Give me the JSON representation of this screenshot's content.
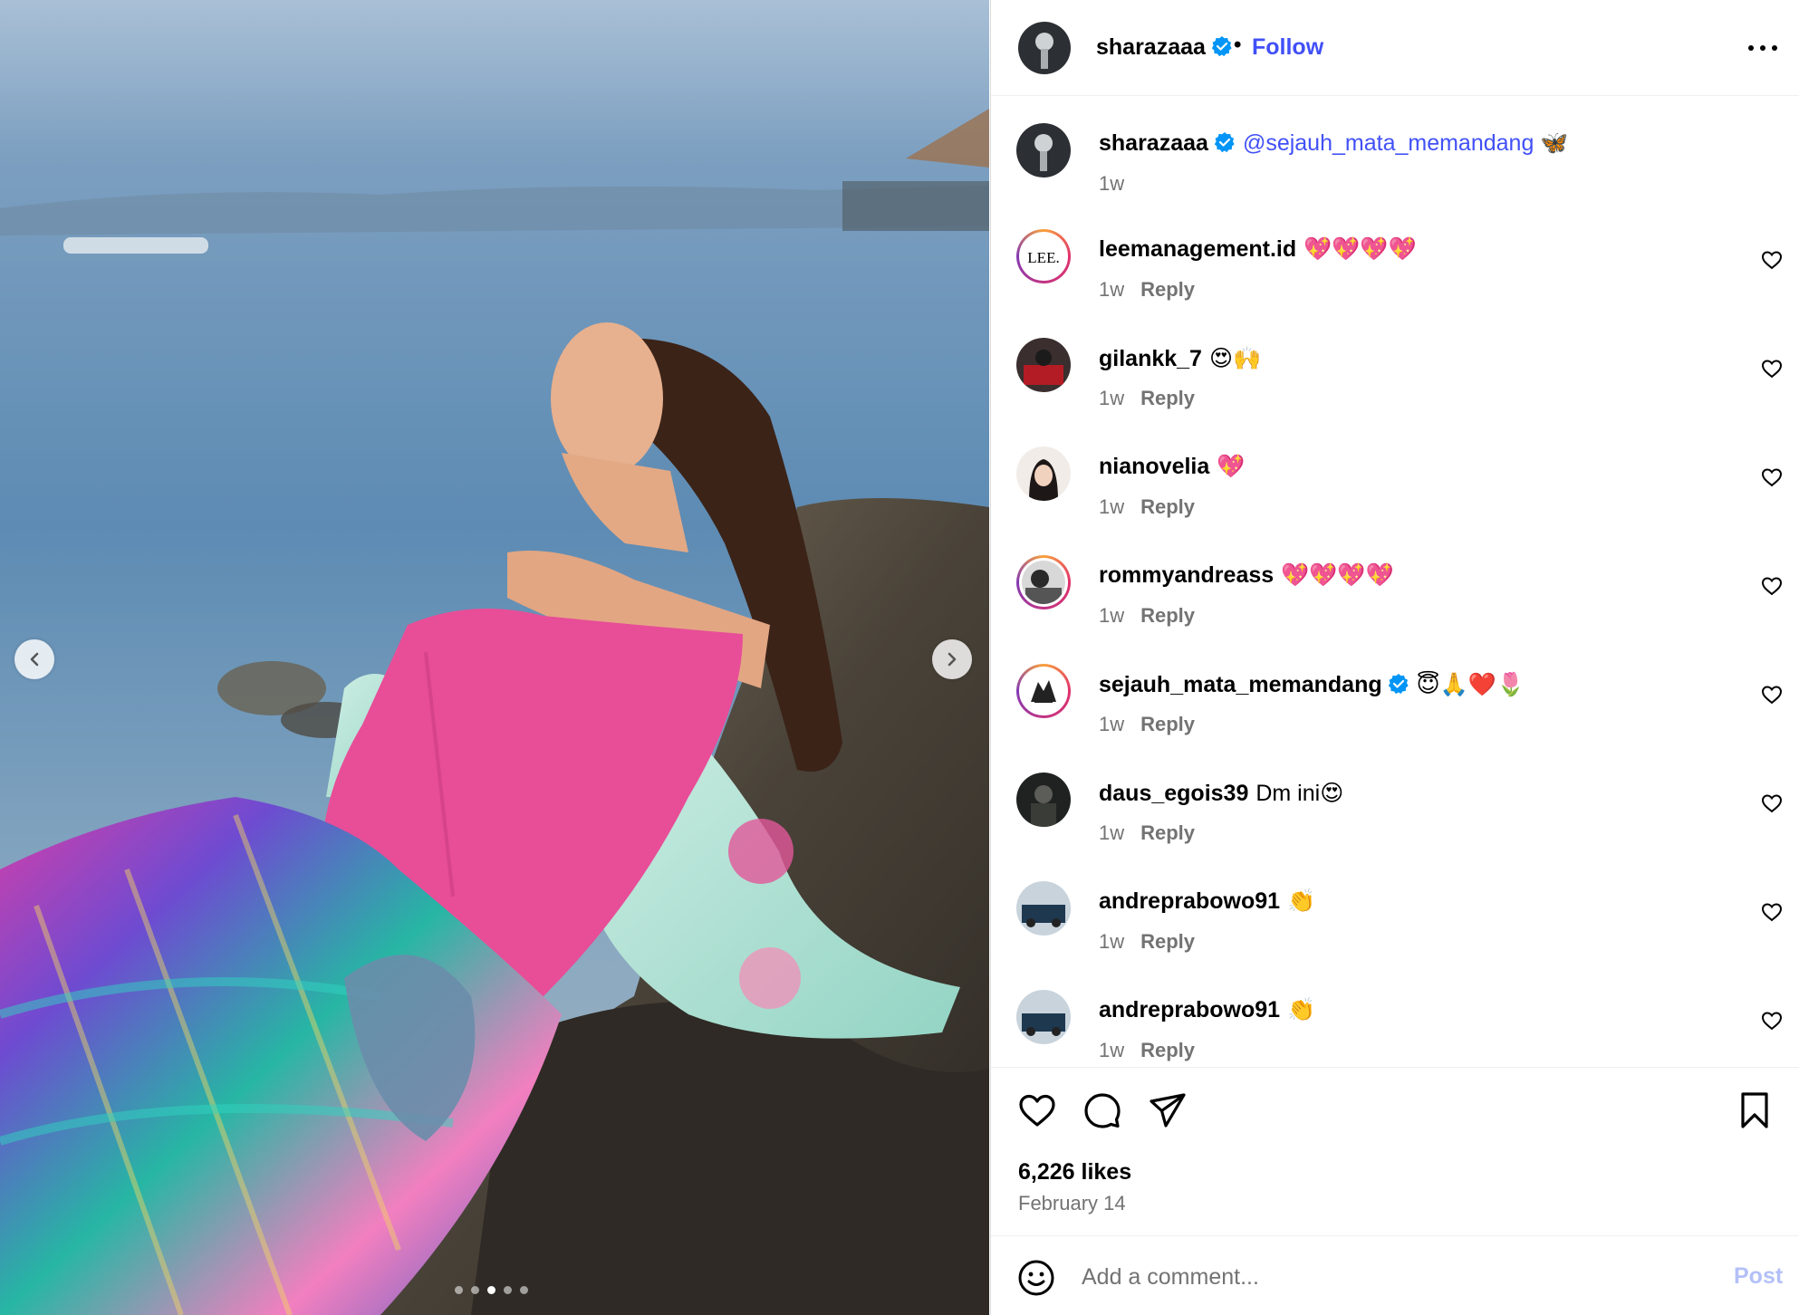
{
  "post": {
    "author": "sharazaaa",
    "follow_label": "Follow",
    "separator": "•",
    "likes": "6,226 likes",
    "date": "February 14",
    "carousel": {
      "count": 5,
      "active_index": 2
    }
  },
  "caption": {
    "user": "sharazaaa",
    "mention": "@sejauh_mata_memandang",
    "emoji": "🦋",
    "time": "1w"
  },
  "comments": [
    {
      "user": "leemanagement.id",
      "text": "💖💖💖💖",
      "time": "1w",
      "reply": "Reply",
      "verified": false
    },
    {
      "user": "gilankk_7",
      "text": "😍🙌",
      "time": "1w",
      "reply": "Reply",
      "verified": false
    },
    {
      "user": "nianovelia",
      "text": "💖",
      "time": "1w",
      "reply": "Reply",
      "verified": false
    },
    {
      "user": "rommyandreass",
      "text": "💖💖💖💖",
      "time": "1w",
      "reply": "Reply",
      "verified": false
    },
    {
      "user": "sejauh_mata_memandang",
      "text": "😇🙏❤️🌷",
      "time": "1w",
      "reply": "Reply",
      "verified": true
    },
    {
      "user": "daus_egois39",
      "text": "Dm ini😍",
      "time": "1w",
      "reply": "Reply",
      "verified": false
    },
    {
      "user": "andreprabowo91",
      "text": "👏",
      "time": "1w",
      "reply": "Reply",
      "verified": false
    },
    {
      "user": "andreprabowo91",
      "text": "👏",
      "time": "1w",
      "reply": "Reply",
      "verified": false
    }
  ],
  "avatar_labels": {
    "lee": "LEE."
  },
  "composer": {
    "placeholder": "Add a comment...",
    "post_label": "Post"
  },
  "colors": {
    "link": "#4150f7",
    "verified": "#0095f6",
    "muted": "#737373",
    "post_disabled": "#b3c0f8"
  }
}
